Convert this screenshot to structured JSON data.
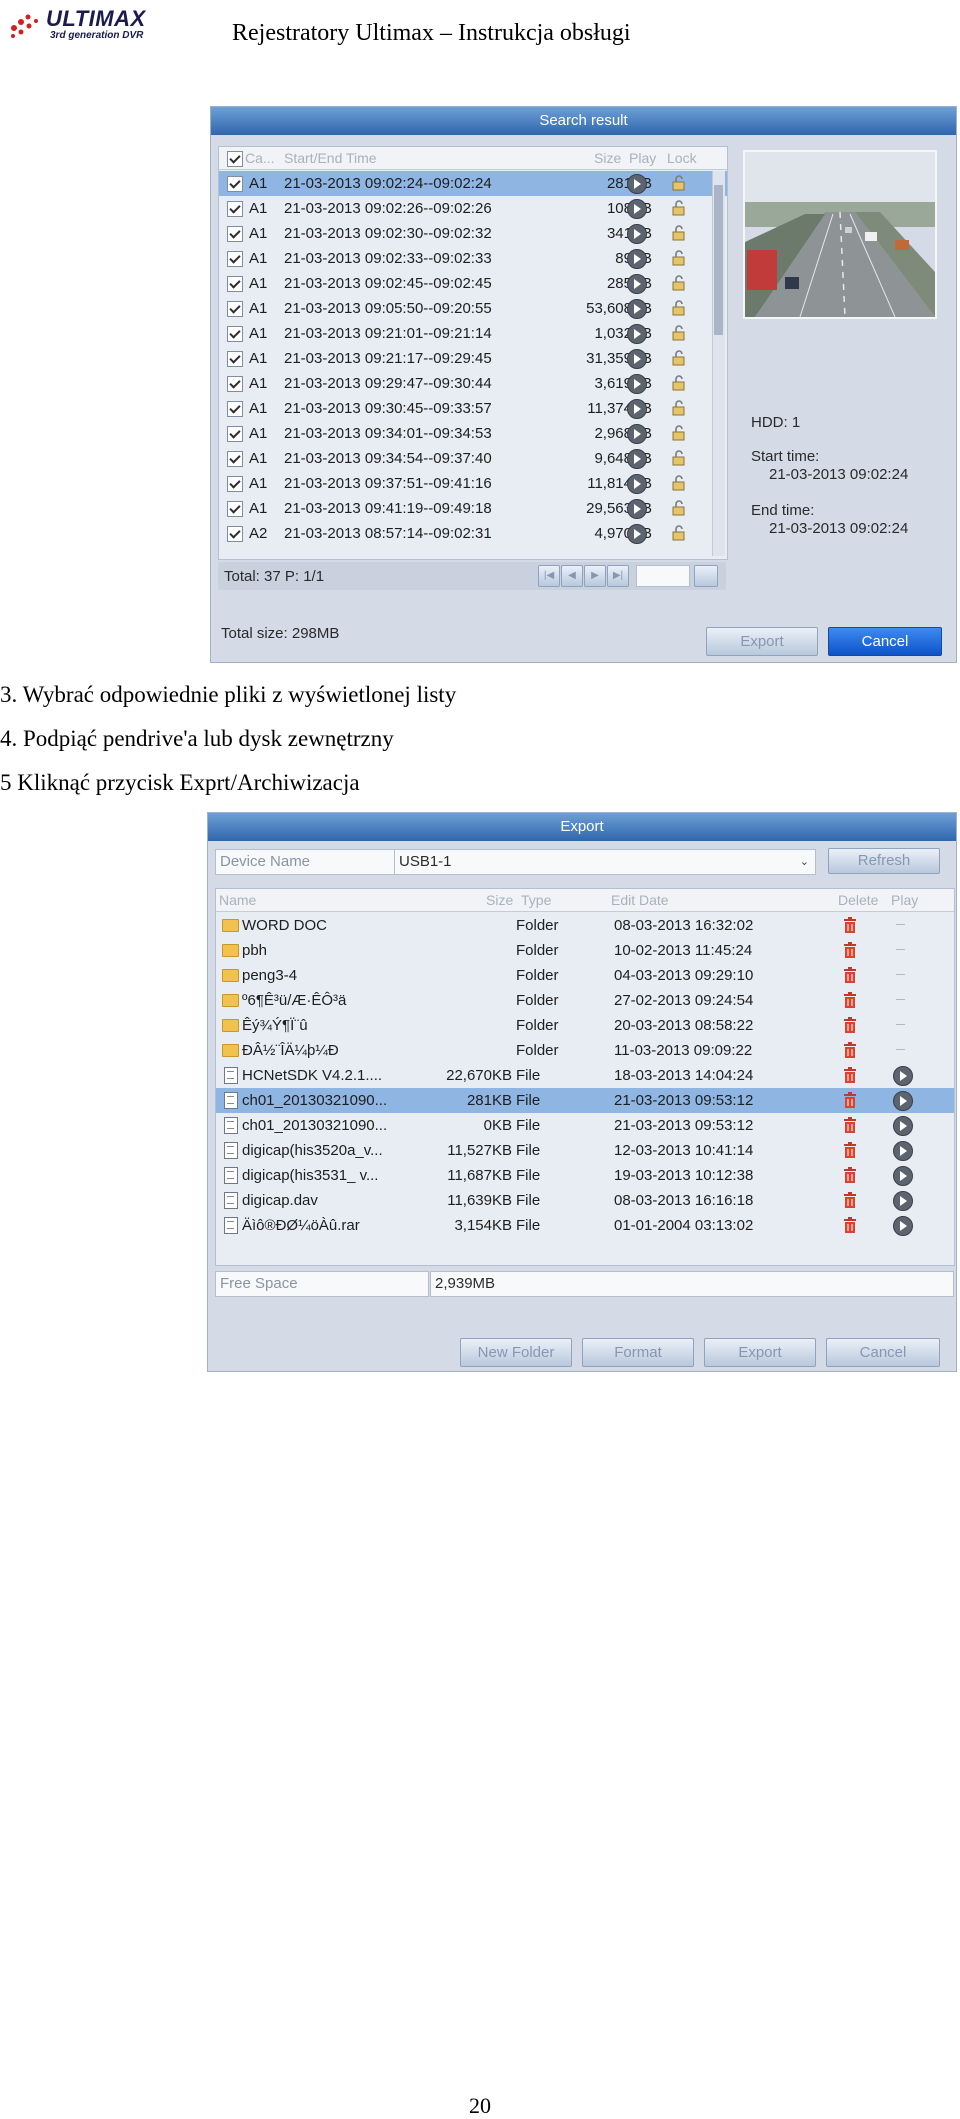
{
  "header": {
    "brand": "ULTIMAX",
    "tagline": "3rd generation DVR",
    "title": "Rejestratory Ultimax – Instrukcja obsługi"
  },
  "search_dialog": {
    "title": "Search result",
    "columns": [
      "Ca...",
      "Start/End Time",
      "Size",
      "Play",
      "Lock"
    ],
    "rows": [
      {
        "cam": "A1",
        "time": "21-03-2013 09:02:24--09:02:24",
        "size": "281KB"
      },
      {
        "cam": "A1",
        "time": "21-03-2013 09:02:26--09:02:26",
        "size": "108KB"
      },
      {
        "cam": "A1",
        "time": "21-03-2013 09:02:30--09:02:32",
        "size": "341KB"
      },
      {
        "cam": "A1",
        "time": "21-03-2013 09:02:33--09:02:33",
        "size": "89KB"
      },
      {
        "cam": "A1",
        "time": "21-03-2013 09:02:45--09:02:45",
        "size": "285KB"
      },
      {
        "cam": "A1",
        "time": "21-03-2013 09:05:50--09:20:55",
        "size": "53,608KB"
      },
      {
        "cam": "A1",
        "time": "21-03-2013 09:21:01--09:21:14",
        "size": "1,032KB"
      },
      {
        "cam": "A1",
        "time": "21-03-2013 09:21:17--09:29:45",
        "size": "31,359KB"
      },
      {
        "cam": "A1",
        "time": "21-03-2013 09:29:47--09:30:44",
        "size": "3,619KB"
      },
      {
        "cam": "A1",
        "time": "21-03-2013 09:30:45--09:33:57",
        "size": "11,374KB"
      },
      {
        "cam": "A1",
        "time": "21-03-2013 09:34:01--09:34:53",
        "size": "2,968KB"
      },
      {
        "cam": "A1",
        "time": "21-03-2013 09:34:54--09:37:40",
        "size": "9,648KB"
      },
      {
        "cam": "A1",
        "time": "21-03-2013 09:37:51--09:41:16",
        "size": "11,814KB"
      },
      {
        "cam": "A1",
        "time": "21-03-2013 09:41:19--09:49:18",
        "size": "29,563KB"
      },
      {
        "cam": "A2",
        "time": "21-03-2013 08:57:14--09:02:31",
        "size": "4,970KB"
      }
    ],
    "total": "Total: 37  P: 1/1",
    "info": {
      "hdd": "HDD: 1",
      "start_label": "Start time:",
      "start_value": "21-03-2013 09:02:24",
      "end_label": "End time:",
      "end_value": "21-03-2013 09:02:24"
    },
    "total_size": "Total size: 298MB",
    "export_label": "Export",
    "cancel_label": "Cancel"
  },
  "steps": [
    "3. Wybrać odpowiednie pliki z wyświetlonej listy",
    "4. Podpiąć pendrive'a lub dysk zewnętrzny",
    "5 Kliknąć przycisk Exprt/Archiwizacja"
  ],
  "export_dialog": {
    "title": "Export",
    "device_label": "Device Name",
    "device_value": "USB1-1",
    "refresh_label": "Refresh",
    "columns": [
      "Name",
      "Size",
      "Type",
      "Edit Date",
      "Delete",
      "Play"
    ],
    "files": [
      {
        "name": "WORD DOC",
        "size": "",
        "type": "Folder",
        "date": "08-03-2013 16:32:02",
        "kind": "folder"
      },
      {
        "name": "pbh",
        "size": "",
        "type": "Folder",
        "date": "10-02-2013 11:45:24",
        "kind": "folder"
      },
      {
        "name": "peng3-4",
        "size": "",
        "type": "Folder",
        "date": "04-03-2013 09:29:10",
        "kind": "folder"
      },
      {
        "name": "º6¶Ê³ü/Æ·ÊÔ³ä",
        "size": "",
        "type": "Folder",
        "date": "27-02-2013 09:24:54",
        "kind": "folder"
      },
      {
        "name": "Êý¾Ý¶Ï¨û",
        "size": "",
        "type": "Folder",
        "date": "20-03-2013 08:58:22",
        "kind": "folder"
      },
      {
        "name": "ÐÂ½¨ÎÄ¼þ¼Ð",
        "size": "",
        "type": "Folder",
        "date": "11-03-2013 09:09:22",
        "kind": "folder"
      },
      {
        "name": "HCNetSDK V4.2.1....",
        "size": "22,670KB",
        "type": "File",
        "date": "18-03-2013 14:04:24",
        "kind": "file"
      },
      {
        "name": "ch01_20130321090...",
        "size": "281KB",
        "type": "File",
        "date": "21-03-2013 09:53:12",
        "kind": "file"
      },
      {
        "name": "ch01_20130321090...",
        "size": "0KB",
        "type": "File",
        "date": "21-03-2013 09:53:12",
        "kind": "file"
      },
      {
        "name": "digicap(his3520a_v...",
        "size": "11,527KB",
        "type": "File",
        "date": "12-03-2013 10:41:14",
        "kind": "file"
      },
      {
        "name": "digicap(his3531_ v...",
        "size": "11,687KB",
        "type": "File",
        "date": "19-03-2013 10:12:38",
        "kind": "file"
      },
      {
        "name": "digicap.dav",
        "size": "11,639KB",
        "type": "File",
        "date": "08-03-2013 16:16:18",
        "kind": "file"
      },
      {
        "name": "Äìô®ÐØ¼öÀû.rar",
        "size": "3,154KB",
        "type": "File",
        "date": "01-01-2004 03:13:02",
        "kind": "file"
      }
    ],
    "free_space_label": "Free Space",
    "free_space_value": "2,939MB",
    "new_folder_label": "New Folder",
    "format_label": "Format",
    "export_label": "Export",
    "cancel_label": "Cancel"
  },
  "page_number": "20"
}
